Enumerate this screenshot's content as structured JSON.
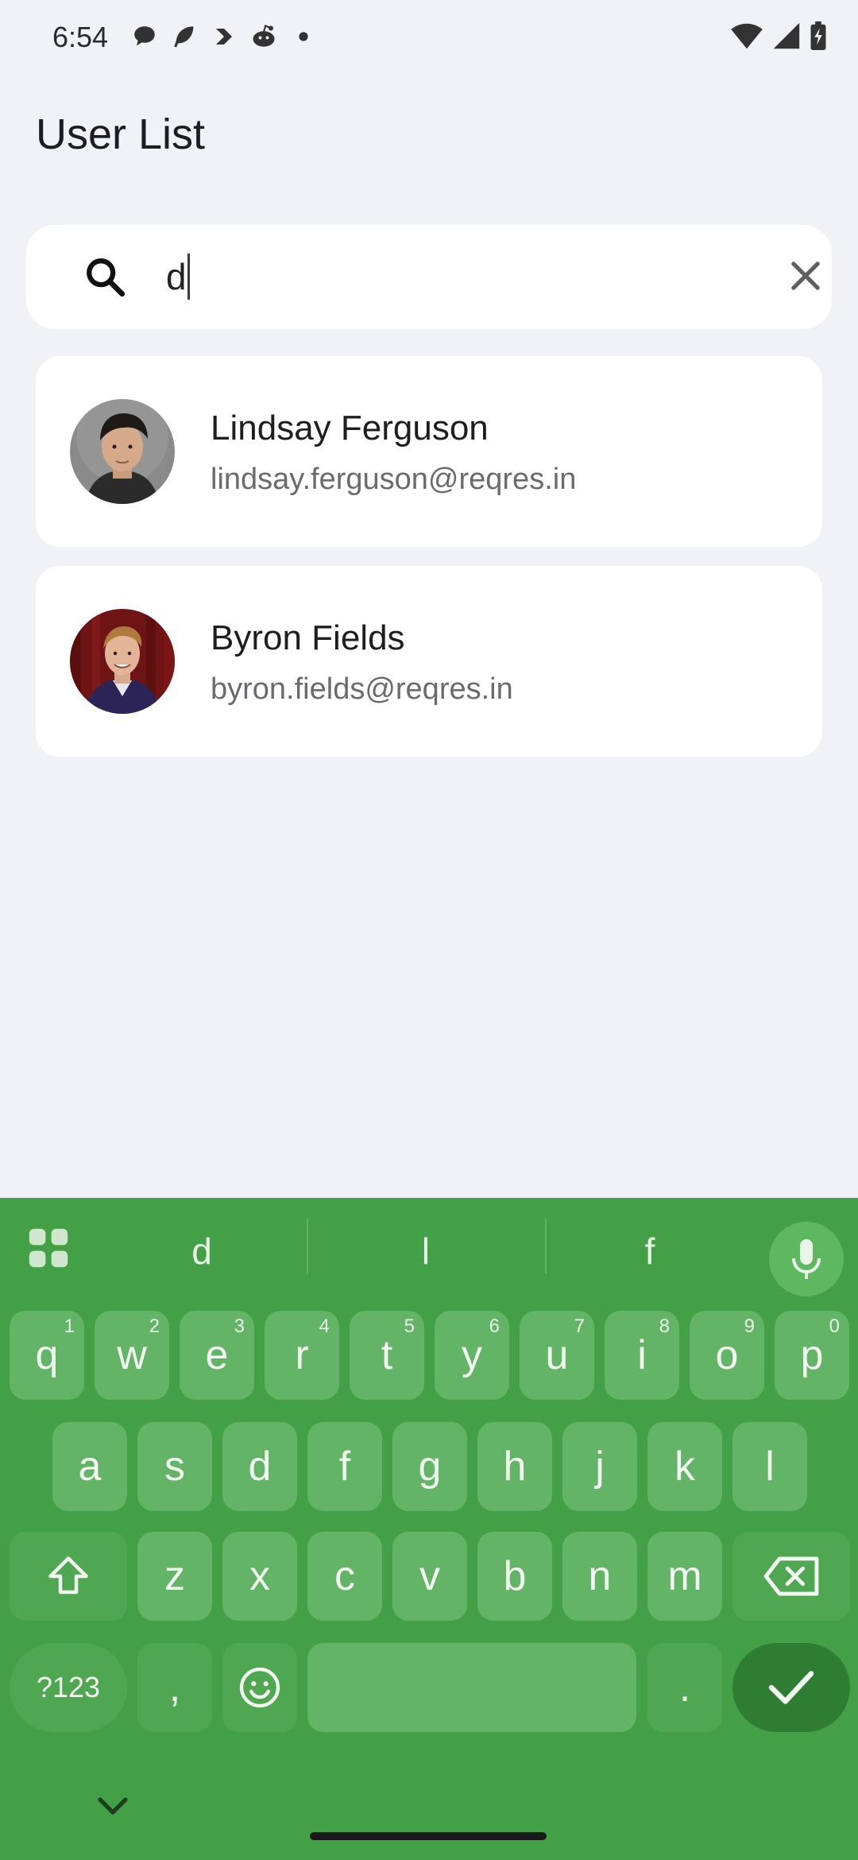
{
  "status_bar": {
    "time": "6:54"
  },
  "header": {
    "title": "User List"
  },
  "search": {
    "value": "d",
    "placeholder": ""
  },
  "users": [
    {
      "name": "Lindsay Ferguson",
      "email": "lindsay.ferguson@reqres.in"
    },
    {
      "name": "Byron Fields",
      "email": "byron.fields@reqres.in"
    }
  ],
  "keyboard": {
    "suggestions": [
      "d",
      "l",
      "f"
    ],
    "row1": [
      {
        "k": "q",
        "h": "1"
      },
      {
        "k": "w",
        "h": "2"
      },
      {
        "k": "e",
        "h": "3"
      },
      {
        "k": "r",
        "h": "4"
      },
      {
        "k": "t",
        "h": "5"
      },
      {
        "k": "y",
        "h": "6"
      },
      {
        "k": "u",
        "h": "7"
      },
      {
        "k": "i",
        "h": "8"
      },
      {
        "k": "o",
        "h": "9"
      },
      {
        "k": "p",
        "h": "0"
      }
    ],
    "row2": [
      "a",
      "s",
      "d",
      "f",
      "g",
      "h",
      "j",
      "k",
      "l"
    ],
    "row3": [
      "z",
      "x",
      "c",
      "v",
      "b",
      "n",
      "m"
    ],
    "symbols_label": "?123",
    "comma": ",",
    "period": "."
  },
  "colors": {
    "keyboard_bg": "#43a047",
    "key_bg": "#63b466",
    "enter_bg": "#2e7d32",
    "page_bg": "#f1f2f6"
  }
}
